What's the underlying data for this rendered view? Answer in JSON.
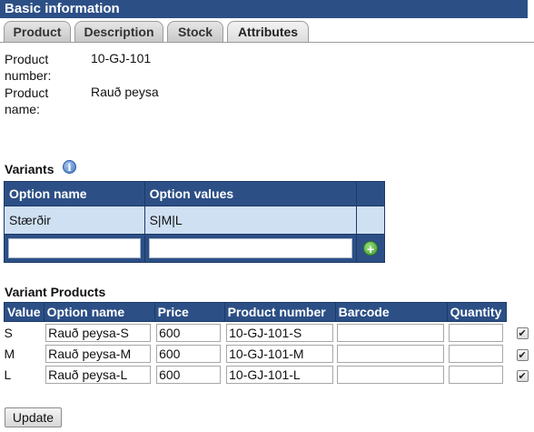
{
  "header": {
    "title": "Basic information"
  },
  "tabs": [
    {
      "label": "Product"
    },
    {
      "label": "Description"
    },
    {
      "label": "Stock"
    },
    {
      "label": "Attributes",
      "active": true
    }
  ],
  "info": {
    "number_label_1": "Product",
    "number_label_2": "number:",
    "number_value": "10-GJ-101",
    "name_label_1": "Product",
    "name_label_2": "name:",
    "name_value": "Rauð peysa"
  },
  "variants": {
    "title": "Variants",
    "columns": [
      "Option name",
      "Option values"
    ],
    "rows": [
      {
        "option_name": "Stærðir",
        "option_values": "S|M|L"
      }
    ]
  },
  "variant_products": {
    "title": "Variant Products",
    "columns": [
      "Value",
      "Option name",
      "Price",
      "Product number",
      "Barcode",
      "Quantity"
    ],
    "rows": [
      {
        "value": "S",
        "option_name": "Rauð peysa-S",
        "price": "600",
        "product_number": "10-GJ-101-S",
        "barcode": "",
        "quantity": "",
        "checked": true
      },
      {
        "value": "M",
        "option_name": "Rauð peysa-M",
        "price": "600",
        "product_number": "10-GJ-101-M",
        "barcode": "",
        "quantity": "",
        "checked": true
      },
      {
        "value": "L",
        "option_name": "Rauð peysa-L",
        "price": "600",
        "product_number": "10-GJ-101-L",
        "barcode": "",
        "quantity": "",
        "checked": true
      }
    ]
  },
  "buttons": {
    "update": "Update"
  },
  "icons": {
    "info": "info-icon",
    "add": "add-icon",
    "check": "checkbox-checked-icon"
  },
  "colors": {
    "header_bg": "#2c4f86",
    "row_bg": "#cfe0f3",
    "add_green": "#3f9b2a"
  }
}
